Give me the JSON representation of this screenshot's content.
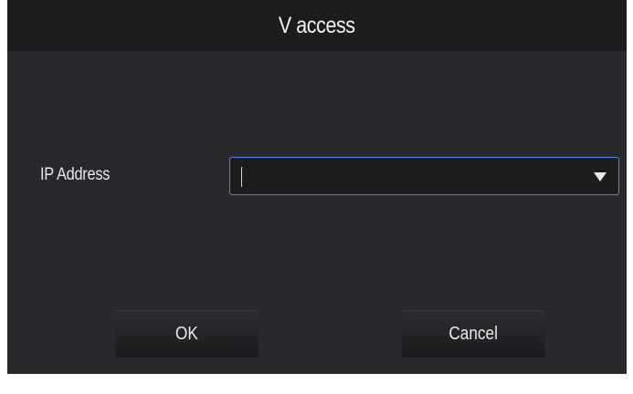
{
  "dialog": {
    "title": "V access",
    "ip_field": {
      "label": "IP Address",
      "value": ""
    },
    "buttons": {
      "ok_label": "OK",
      "cancel_label": "Cancel"
    }
  },
  "icons": {
    "dropdown": "chevron-down-icon"
  },
  "colors": {
    "dialog_background": "#29282d",
    "title_bar": "#1c1c1e",
    "focus_border": "#4a89d8",
    "text": "#e6e6e6"
  }
}
